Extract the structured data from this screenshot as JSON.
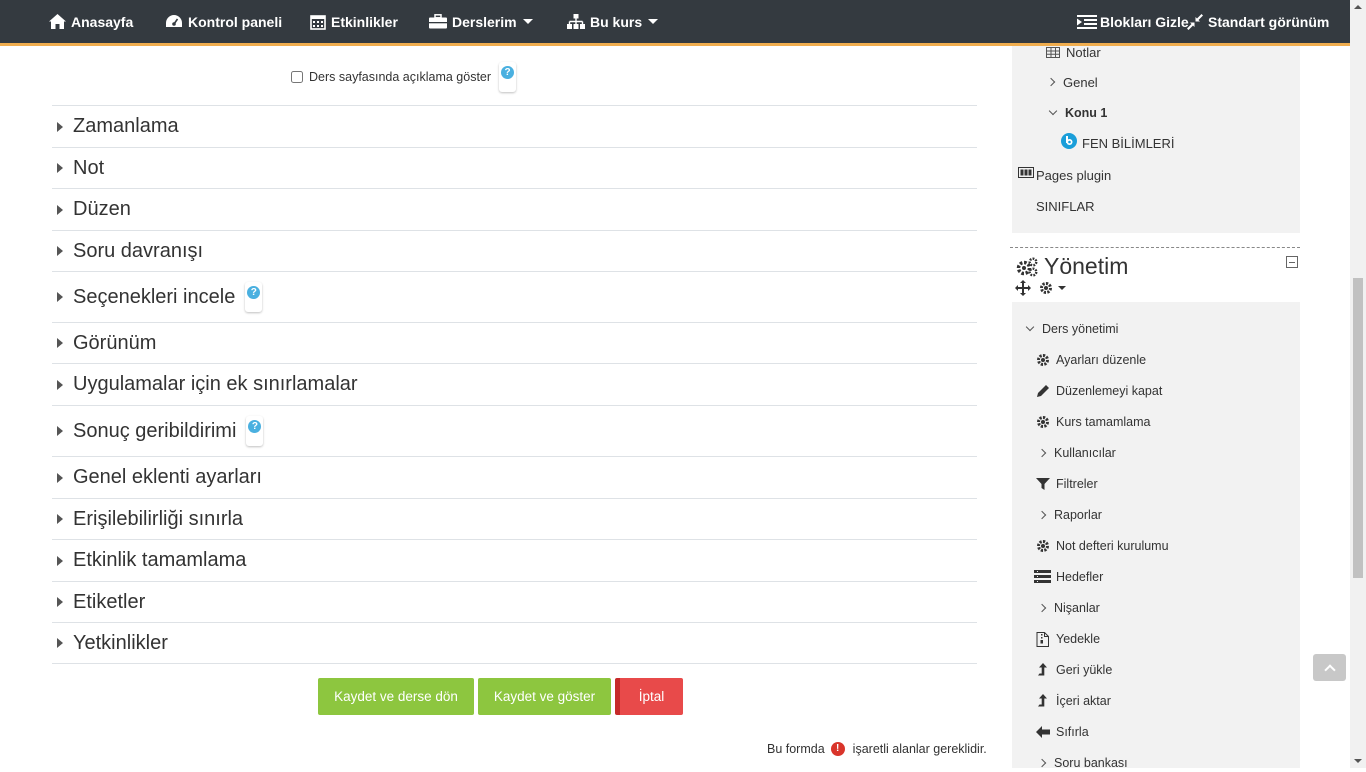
{
  "nav": {
    "home": "Anasayfa",
    "dashboard": "Kontrol paneli",
    "events": "Etkinlikler",
    "mycourses": "Derslerim",
    "thiscourse": "Bu kurs",
    "hide_blocks": "Blokları Gizle",
    "standard_view": "Standart görünüm"
  },
  "form": {
    "show_description": "Ders sayfasında açıklama göster",
    "sections": [
      "Zamanlama",
      "Not",
      "Düzen",
      "Soru davranışı",
      "Seçenekleri incele",
      "Görünüm",
      "Uygulamalar için ek sınırlamalar",
      "Sonuç geribildirimi",
      "Genel eklenti ayarları",
      "Erişilebilirliği sınırla",
      "Etkinlik tamamlama",
      "Etiketler",
      "Yetkinlikler"
    ],
    "save_return": "Kaydet ve derse dön",
    "save_display": "Kaydet ve göster",
    "cancel": "İptal",
    "required_before": "Bu formda",
    "required_after": "işaretli alanlar gereklidir."
  },
  "navigation_block": {
    "notes": "Notlar",
    "general": "Genel",
    "topic1": "Konu 1",
    "fen": "FEN BİLİMLERİ",
    "pages_plugin": "Pages plugin",
    "classes": "SINIFLAR"
  },
  "admin_block": {
    "title": "Yönetim",
    "course_admin": "Ders yönetimi",
    "items": [
      "Ayarları düzenle",
      "Düzenlemeyi kapat",
      "Kurs tamamlama",
      "Kullanıcılar",
      "Filtreler",
      "Raporlar",
      "Not defteri kurulumu",
      "Hedefler",
      "Nişanlar",
      "Yedekle",
      "Geri yükle",
      "İçeri aktar",
      "Sıfırla",
      "Soru bankası"
    ]
  },
  "colors": {
    "navbar": "#343a40",
    "navbar_accent": "#f0ad4e",
    "button_green": "#8dc63f",
    "button_red": "#e84a4a",
    "help": "#4ab0e0"
  }
}
